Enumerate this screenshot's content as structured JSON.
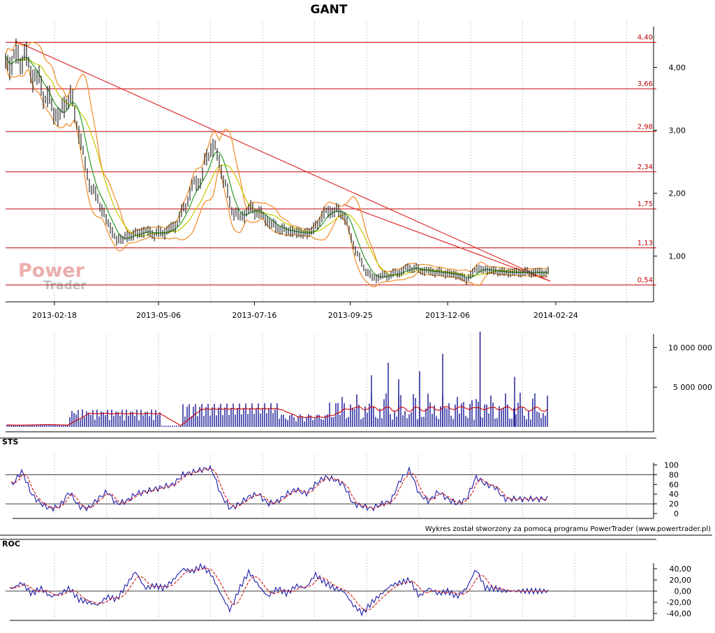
{
  "title": "GANT",
  "footer_text": "Wykres został stworzony za pomocą programu PowerTrader (www.powertrader.pl)",
  "logo": {
    "line1": "Power",
    "line2": "Trader"
  },
  "colors": {
    "level": "#c00000",
    "trend": "#e03030",
    "price": "#000000",
    "ma_short": "#2a9a2a",
    "ma_long": "#c8c800",
    "bands": "#f08a24",
    "volume": "#00008b",
    "volume_ma": "#d00000",
    "osc": "#1c1caa",
    "osc_signal": "#d01818"
  },
  "chart_data": [
    {
      "type": "line",
      "panel": "price",
      "title": "GANT",
      "x_tick_labels": [
        "2013-02-18",
        "2013-05-06",
        "2013-07-16",
        "2013-09-25",
        "2013-12-06",
        "2014-02-24"
      ],
      "y_tick_labels": [
        "1,00",
        "2,00",
        "3,00",
        "4,00"
      ],
      "y_ticks": [
        1.0,
        2.0,
        3.0,
        4.0
      ],
      "ylim": [
        0.3,
        4.6
      ],
      "grid": true,
      "horizontal_levels": [
        {
          "label": "4,40",
          "value": 4.4
        },
        {
          "label": "3,66",
          "value": 3.66
        },
        {
          "label": "2,98",
          "value": 2.98
        },
        {
          "label": "2,34",
          "value": 2.34
        },
        {
          "label": "1,75",
          "value": 1.75
        },
        {
          "label": "1,13",
          "value": 1.13
        },
        {
          "label": "0,54",
          "value": 0.54
        }
      ],
      "trendlines": [
        {
          "from": [
            "2013-01-20",
            4.42
          ],
          "to": [
            "2014-02-20",
            0.6
          ]
        },
        {
          "from": [
            "2013-09-20",
            1.82
          ],
          "to": [
            "2014-02-20",
            0.6
          ]
        }
      ],
      "series": [
        {
          "kind": "close",
          "points": [
            [
              "2013-01-18",
              4.1
            ],
            [
              "2013-01-25",
              4.2
            ],
            [
              "2013-02-01",
              3.95
            ],
            [
              "2013-02-08",
              3.7
            ],
            [
              "2013-02-15",
              3.4
            ],
            [
              "2013-02-22",
              3.2
            ],
            [
              "2013-03-01",
              3.6
            ],
            [
              "2013-03-08",
              3.0
            ],
            [
              "2013-03-15",
              2.2
            ],
            [
              "2013-03-22",
              1.9
            ],
            [
              "2013-03-29",
              1.55
            ],
            [
              "2013-04-05",
              1.25
            ],
            [
              "2013-04-12",
              1.3
            ],
            [
              "2013-04-19",
              1.35
            ],
            [
              "2013-04-26",
              1.4
            ],
            [
              "2013-05-03",
              1.35
            ],
            [
              "2013-05-10",
              1.38
            ],
            [
              "2013-05-17",
              1.45
            ],
            [
              "2013-05-24",
              1.7
            ],
            [
              "2013-05-31",
              2.1
            ],
            [
              "2013-06-07",
              2.25
            ],
            [
              "2013-06-14",
              2.8
            ],
            [
              "2013-06-21",
              2.45
            ],
            [
              "2013-06-28",
              1.8
            ],
            [
              "2013-07-05",
              1.6
            ],
            [
              "2013-07-12",
              1.75
            ],
            [
              "2013-07-19",
              1.7
            ],
            [
              "2013-07-26",
              1.55
            ],
            [
              "2013-08-02",
              1.45
            ],
            [
              "2013-08-09",
              1.4
            ],
            [
              "2013-08-16",
              1.38
            ],
            [
              "2013-08-23",
              1.35
            ],
            [
              "2013-08-30",
              1.45
            ],
            [
              "2013-09-06",
              1.7
            ],
            [
              "2013-09-13",
              1.72
            ],
            [
              "2013-09-20",
              1.68
            ],
            [
              "2013-09-27",
              1.2
            ],
            [
              "2013-10-04",
              0.85
            ],
            [
              "2013-10-11",
              0.65
            ],
            [
              "2013-10-18",
              0.68
            ],
            [
              "2013-10-25",
              0.7
            ],
            [
              "2013-11-01",
              0.75
            ],
            [
              "2013-11-08",
              0.82
            ],
            [
              "2013-11-15",
              0.78
            ],
            [
              "2013-11-22",
              0.76
            ],
            [
              "2013-11-29",
              0.74
            ],
            [
              "2013-12-06",
              0.72
            ],
            [
              "2013-12-13",
              0.7
            ],
            [
              "2013-12-20",
              0.62
            ],
            [
              "2013-12-27",
              0.8
            ],
            [
              "2014-01-03",
              0.78
            ],
            [
              "2014-01-10",
              0.76
            ],
            [
              "2014-01-17",
              0.74
            ]
          ]
        }
      ]
    },
    {
      "type": "bar",
      "panel": "volume",
      "y_tick_labels": [
        "5 000 000",
        "10 000 000"
      ],
      "y_ticks": [
        5000000,
        10000000
      ],
      "ylim": [
        0,
        12500000
      ],
      "peak": {
        "date": "2013-12-30",
        "value": 12000000
      }
    },
    {
      "type": "line",
      "panel": "sts",
      "name": "STS",
      "y_tick_labels": [
        "0",
        "20",
        "40",
        "60",
        "80",
        "100"
      ],
      "y_ticks": [
        0,
        20,
        40,
        60,
        80,
        100
      ],
      "ylim": [
        0,
        100
      ],
      "reference_lines": [
        20,
        80
      ],
      "points": [
        [
          "2013-01-18",
          60
        ],
        [
          "2013-01-25",
          88
        ],
        [
          "2013-02-01",
          40
        ],
        [
          "2013-02-08",
          20
        ],
        [
          "2013-02-15",
          10
        ],
        [
          "2013-02-22",
          15
        ],
        [
          "2013-03-01",
          45
        ],
        [
          "2013-03-08",
          15
        ],
        [
          "2013-03-15",
          10
        ],
        [
          "2013-03-22",
          30
        ],
        [
          "2013-03-29",
          45
        ],
        [
          "2013-04-05",
          20
        ],
        [
          "2013-04-12",
          25
        ],
        [
          "2013-04-19",
          40
        ],
        [
          "2013-04-26",
          45
        ],
        [
          "2013-05-03",
          50
        ],
        [
          "2013-05-10",
          55
        ],
        [
          "2013-05-17",
          60
        ],
        [
          "2013-05-24",
          80
        ],
        [
          "2013-05-31",
          85
        ],
        [
          "2013-06-07",
          90
        ],
        [
          "2013-06-14",
          95
        ],
        [
          "2013-06-21",
          40
        ],
        [
          "2013-06-28",
          10
        ],
        [
          "2013-07-05",
          20
        ],
        [
          "2013-07-12",
          35
        ],
        [
          "2013-07-19",
          40
        ],
        [
          "2013-07-26",
          20
        ],
        [
          "2013-08-02",
          25
        ],
        [
          "2013-08-09",
          40
        ],
        [
          "2013-08-16",
          50
        ],
        [
          "2013-08-23",
          40
        ],
        [
          "2013-08-30",
          60
        ],
        [
          "2013-09-06",
          75
        ],
        [
          "2013-09-13",
          70
        ],
        [
          "2013-09-20",
          60
        ],
        [
          "2013-09-27",
          20
        ],
        [
          "2013-10-04",
          15
        ],
        [
          "2013-10-11",
          10
        ],
        [
          "2013-10-18",
          20
        ],
        [
          "2013-10-25",
          25
        ],
        [
          "2013-11-01",
          70
        ],
        [
          "2013-11-08",
          90
        ],
        [
          "2013-11-15",
          40
        ],
        [
          "2013-11-22",
          25
        ],
        [
          "2013-11-29",
          45
        ],
        [
          "2013-12-06",
          30
        ],
        [
          "2013-12-13",
          20
        ],
        [
          "2013-12-20",
          30
        ],
        [
          "2013-12-27",
          75
        ],
        [
          "2014-01-03",
          60
        ],
        [
          "2014-01-10",
          55
        ],
        [
          "2014-01-17",
          30
        ]
      ]
    },
    {
      "type": "line",
      "panel": "roc",
      "name": "ROC",
      "y_tick_labels": [
        "-40,00",
        "-20,00",
        "0,00",
        "20,00",
        "40,00"
      ],
      "y_ticks": [
        -40,
        -20,
        0,
        20,
        40
      ],
      "ylim": [
        -45,
        45
      ],
      "reference_lines": [
        0
      ],
      "points": [
        [
          "2013-01-18",
          5
        ],
        [
          "2013-01-25",
          15
        ],
        [
          "2013-02-01",
          -5
        ],
        [
          "2013-02-08",
          5
        ],
        [
          "2013-02-15",
          -10
        ],
        [
          "2013-02-22",
          -5
        ],
        [
          "2013-03-01",
          5
        ],
        [
          "2013-03-08",
          -15
        ],
        [
          "2013-03-15",
          -20
        ],
        [
          "2013-03-22",
          -25
        ],
        [
          "2013-03-29",
          -10
        ],
        [
          "2013-04-05",
          -15
        ],
        [
          "2013-04-12",
          10
        ],
        [
          "2013-04-19",
          35
        ],
        [
          "2013-04-26",
          5
        ],
        [
          "2013-05-03",
          10
        ],
        [
          "2013-05-10",
          5
        ],
        [
          "2013-05-17",
          20
        ],
        [
          "2013-05-24",
          40
        ],
        [
          "2013-05-31",
          35
        ],
        [
          "2013-06-07",
          45
        ],
        [
          "2013-06-14",
          30
        ],
        [
          "2013-06-21",
          -5
        ],
        [
          "2013-06-28",
          -35
        ],
        [
          "2013-07-05",
          5
        ],
        [
          "2013-07-12",
          35
        ],
        [
          "2013-07-19",
          10
        ],
        [
          "2013-07-26",
          -10
        ],
        [
          "2013-08-02",
          5
        ],
        [
          "2013-08-09",
          -5
        ],
        [
          "2013-08-16",
          10
        ],
        [
          "2013-08-23",
          5
        ],
        [
          "2013-08-30",
          30
        ],
        [
          "2013-09-06",
          15
        ],
        [
          "2013-09-13",
          5
        ],
        [
          "2013-09-20",
          0
        ],
        [
          "2013-09-27",
          -25
        ],
        [
          "2013-10-04",
          -40
        ],
        [
          "2013-10-11",
          -20
        ],
        [
          "2013-10-18",
          -5
        ],
        [
          "2013-10-25",
          10
        ],
        [
          "2013-11-01",
          15
        ],
        [
          "2013-11-08",
          20
        ],
        [
          "2013-11-15",
          -10
        ],
        [
          "2013-11-22",
          5
        ],
        [
          "2013-11-29",
          -5
        ],
        [
          "2013-12-06",
          0
        ],
        [
          "2013-12-13",
          -10
        ],
        [
          "2013-12-20",
          5
        ],
        [
          "2013-12-27",
          40
        ],
        [
          "2014-01-03",
          5
        ],
        [
          "2014-01-10",
          5
        ],
        [
          "2014-01-17",
          0
        ]
      ]
    }
  ]
}
